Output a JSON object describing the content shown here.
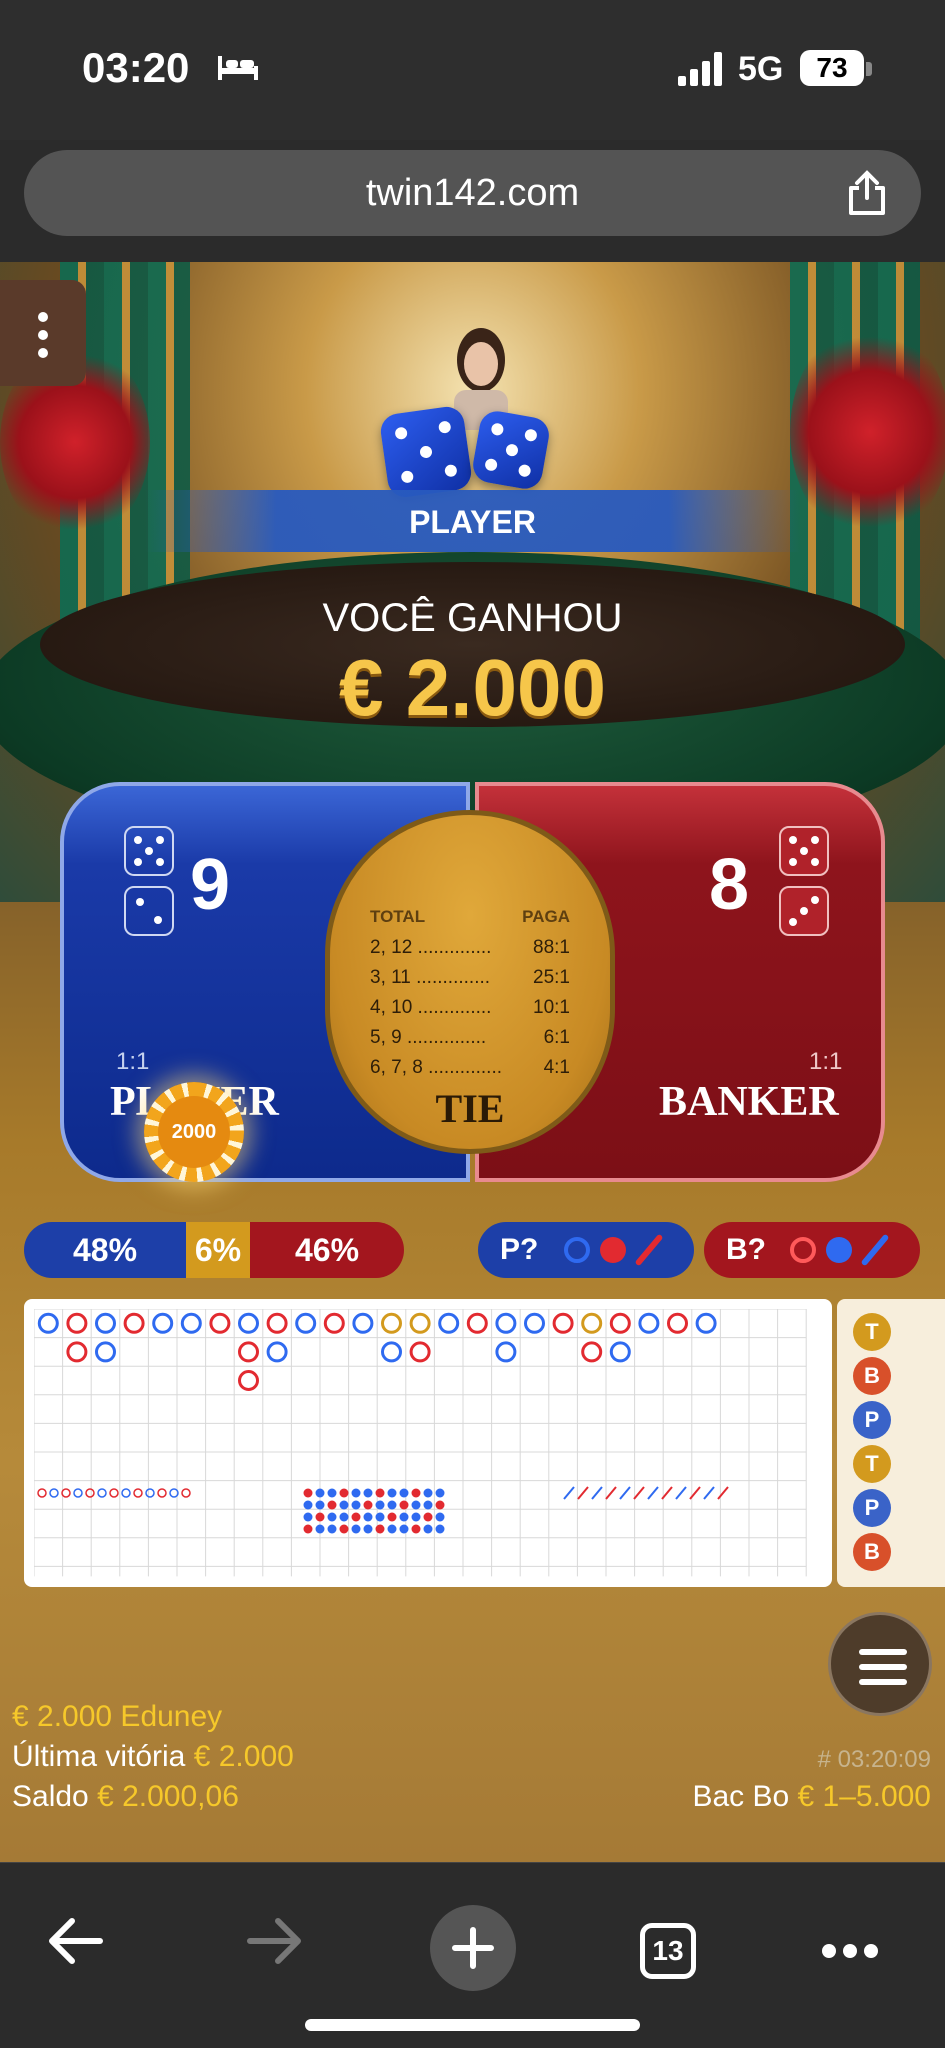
{
  "status_bar": {
    "time": "03:20",
    "network": "5G",
    "battery": "73"
  },
  "browser": {
    "url": "twin142.com",
    "tabs_count": "13"
  },
  "game": {
    "result_banner": "PLAYER",
    "win_title": "VOCÊ GANHOU",
    "win_amount": "€ 2.000",
    "player": {
      "score": "9",
      "ratio": "1:1",
      "label": "PLAYER",
      "chip_value": "2000",
      "dice": [
        5,
        2
      ]
    },
    "banker": {
      "score": "8",
      "ratio": "1:1",
      "label": "BANKER",
      "dice": [
        5,
        3
      ]
    },
    "tie": {
      "label": "TIE",
      "header_total": "TOTAL",
      "header_paga": "PAGA",
      "rows": [
        {
          "total": "2, 12 ..............",
          "pays": "88:1"
        },
        {
          "total": "3, 11 ..............",
          "pays": "25:1"
        },
        {
          "total": "4, 10 ..............",
          "pays": "10:1"
        },
        {
          "total": "5, 9 ...............",
          "pays": "6:1"
        },
        {
          "total": "6, 7, 8 ..............",
          "pays": "4:1"
        }
      ]
    },
    "stats": {
      "player_pct": "48%",
      "tie_pct": "6%",
      "banker_pct": "46%"
    },
    "predict_player": "P?",
    "predict_banker": "B?",
    "side_road": [
      "T",
      "B",
      "P",
      "T",
      "P",
      "B"
    ]
  },
  "colors": {
    "player_blue": "#1a3aa8",
    "banker_red": "#8e141c",
    "tie_gold": "#c88a24",
    "accent_yellow": "#f6c82a"
  },
  "footer": {
    "bet_line": "€ 2.000 Eduney",
    "last_win_label": "Última vitória",
    "last_win_value": "€ 2.000",
    "balance_label": "Saldo",
    "balance_value": "€ 2.000,06",
    "round_id": "# 03:20:09",
    "game_name": "Bac Bo",
    "limits": "€ 1–5.000"
  }
}
